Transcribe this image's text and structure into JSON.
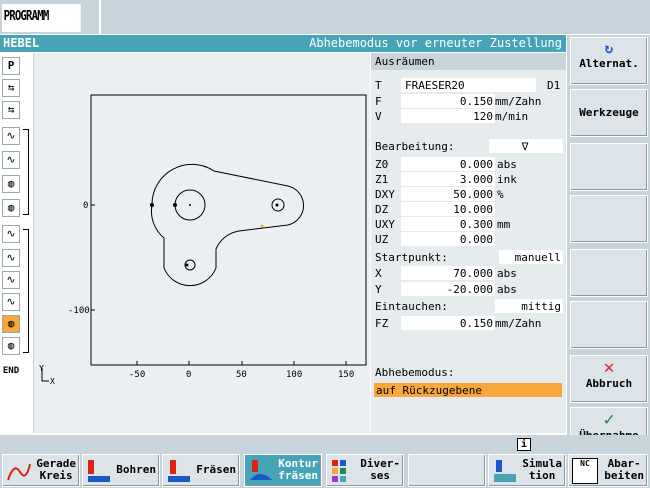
{
  "topbar": {
    "title": "PROGRAMM"
  },
  "header": {
    "left": "HEBEL",
    "right": "Abhebemodus vor erneuter Zustellung"
  },
  "left_icons": {
    "p": "P",
    "end": "END"
  },
  "graphic": {
    "x_ticks": [
      "-50",
      "0",
      "50",
      "100",
      "150"
    ],
    "y_ticks": [
      "0",
      "-100"
    ],
    "axis_x": "X",
    "axis_y": "Y"
  },
  "params": {
    "title": "Ausräumen",
    "T": {
      "label": "T",
      "value": "FRAESER20",
      "suffix": "D1"
    },
    "F": {
      "label": "F",
      "value": "0.150",
      "unit": "mm/Zahn"
    },
    "V": {
      "label": "V",
      "value": "120",
      "unit": "m/min"
    },
    "bearbeitung": {
      "label": "Bearbeitung:",
      "value": "∇"
    },
    "Z0": {
      "label": "Z0",
      "value": "0.000",
      "unit": "abs"
    },
    "Z1": {
      "label": "Z1",
      "value": "3.000",
      "unit": "ink"
    },
    "DXY": {
      "label": "DXY",
      "value": "50.000",
      "unit": "%"
    },
    "DZ": {
      "label": "DZ",
      "value": "10.000",
      "unit": ""
    },
    "UXY": {
      "label": "UXY",
      "value": "0.300",
      "unit": "mm"
    },
    "UZ": {
      "label": "UZ",
      "value": "0.000",
      "unit": ""
    },
    "startpunkt": {
      "label": "Startpunkt:",
      "value": "manuell"
    },
    "X": {
      "label": "X",
      "value": "70.000",
      "unit": "abs"
    },
    "Y": {
      "label": "Y",
      "value": "-20.000",
      "unit": "abs"
    },
    "eintauchen": {
      "label": "Eintauchen:",
      "value": "mittig"
    },
    "FZ": {
      "label": "FZ",
      "value": "0.150",
      "unit": "mm/Zahn"
    },
    "abhebemodus": {
      "label": "Abhebemodus:",
      "value": "auf Rückzugebene"
    }
  },
  "right_softkeys": {
    "alternat": "Alternat.",
    "werkzeuge": "Werkzeuge",
    "abbruch": "Abbruch",
    "uebernahme": "Übernahme"
  },
  "bottom_softkeys": {
    "gerade_kreis": [
      "Gerade",
      "Kreis"
    ],
    "bohren": "Bohren",
    "fraesen": "Fräsen",
    "kontur_fraesen": [
      "Kontur",
      "fräsen"
    ],
    "diverses": [
      "Diver-",
      "ses"
    ],
    "simulation": [
      "Simula",
      "tion"
    ],
    "abarbeiten": [
      "Abar-",
      "beiten"
    ],
    "nc_badge": "NC",
    "info": "i"
  },
  "colors": {
    "accent": "#47a3b8",
    "highlight": "#f7a73b",
    "panel": "#c8d4dc"
  }
}
